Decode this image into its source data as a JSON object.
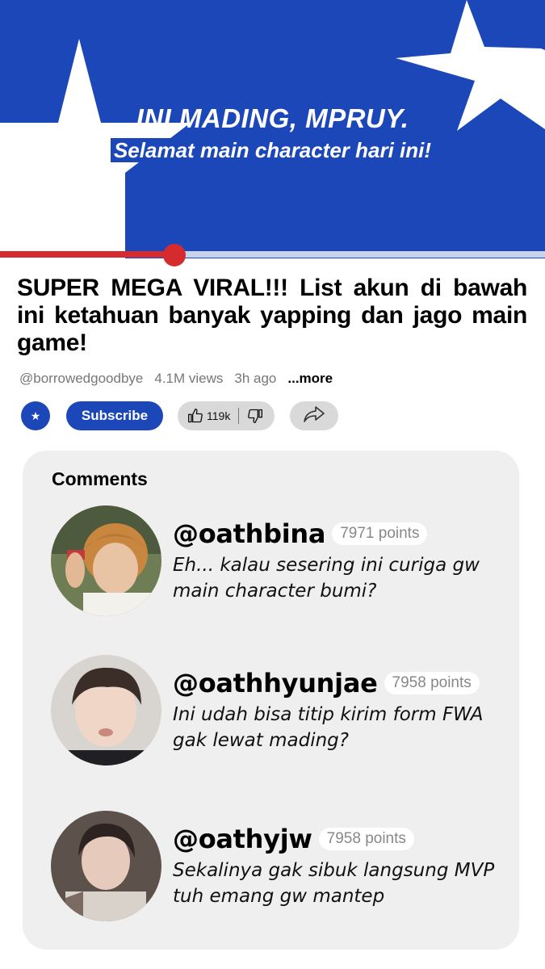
{
  "banner": {
    "title": "INI MADING, MPRUY.",
    "subtitle": "Selamat main character hari ini!",
    "colors": {
      "blue": "#1b47b8",
      "white": "#ffffff"
    }
  },
  "player": {
    "progress": 0.32,
    "accent": "#d52b2e"
  },
  "video": {
    "title": "SUPER MEGA VIRAL!!! List akun di bawah ini ketahuan banyak yapping dan jago main game!",
    "channel": "@borrowedgoodbye",
    "views": "4.1M views",
    "age": "3h ago",
    "more_label": "...more"
  },
  "actions": {
    "channel_icon": "star-icon",
    "subscribe_label": "Subscribe",
    "like_count": "119k",
    "like_icon": "thumbs-up-icon",
    "dislike_icon": "thumbs-down-icon",
    "share_icon": "share-icon"
  },
  "comments": {
    "title": "Comments",
    "items": [
      {
        "handle": "@oathbina",
        "points": "7971 points",
        "text": "Eh... kalau sesering ini curiga gw main character bumi?"
      },
      {
        "handle": "@oathhyunjae",
        "points": "7958 points",
        "text": "Ini udah bisa titip kirim form FWA gak lewat mading?"
      },
      {
        "handle": "@oathyjw",
        "points": "7958 points",
        "text": "Sekalinya gak sibuk langsung MVP tuh emang gw mantep"
      }
    ]
  }
}
